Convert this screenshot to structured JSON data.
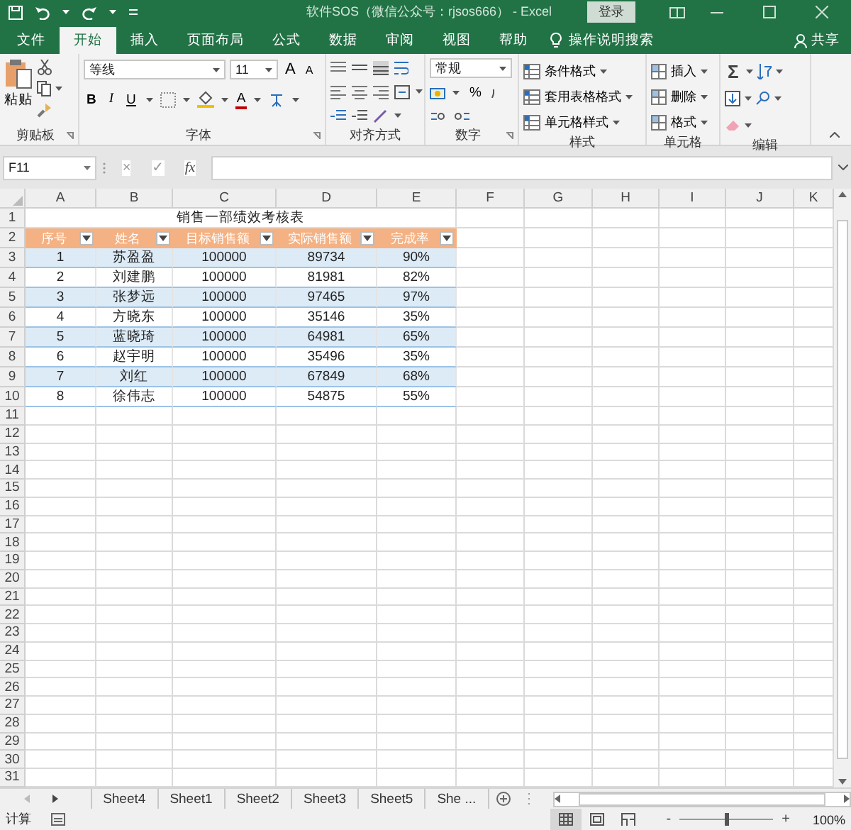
{
  "title_bar": {
    "title": "软件SOS（微信公众号：rjsos666） - Excel",
    "sign_in": "登录"
  },
  "ribbon_tabs": [
    {
      "label": "文件",
      "selected": false
    },
    {
      "label": "开始",
      "selected": true
    },
    {
      "label": "插入",
      "selected": false
    },
    {
      "label": "页面布局",
      "selected": false
    },
    {
      "label": "公式",
      "selected": false
    },
    {
      "label": "数据",
      "selected": false
    },
    {
      "label": "审阅",
      "selected": false
    },
    {
      "label": "视图",
      "selected": false
    },
    {
      "label": "帮助",
      "selected": false
    }
  ],
  "tell_me": "操作说明搜索",
  "share": "共享",
  "ribbon": {
    "clipboard": {
      "paste": "粘贴",
      "label": "剪贴板"
    },
    "font": {
      "font_name": "等线",
      "font_size": "11",
      "grow": "A",
      "shrink": "A",
      "bold": "B",
      "italic": "I",
      "underline": "U",
      "text_color_label": "A",
      "label": "字体"
    },
    "alignment": {
      "label": "对齐方式"
    },
    "number": {
      "format": "常规",
      "percent": "%",
      "label": "数字"
    },
    "styles": {
      "commands": [
        "条件格式",
        "套用表格格式",
        "单元格样式"
      ],
      "label": "样式"
    },
    "cells": {
      "commands": [
        "插入",
        "删除",
        "格式"
      ],
      "label": "单元格"
    },
    "editing": {
      "sum": "Σ",
      "label": "编辑"
    }
  },
  "formula_bar": {
    "name_box": "F11",
    "cancel": "×",
    "enter": "✓",
    "function": "fx"
  },
  "sheet": {
    "columns": [
      "A",
      "B",
      "C",
      "D",
      "E",
      "F",
      "G",
      "H",
      "I",
      "J",
      "K"
    ],
    "row_numbers": [
      "1",
      "2",
      "3",
      "4",
      "5",
      "6",
      "7",
      "8",
      "9",
      "10",
      "11",
      "12",
      "13",
      "14",
      "15",
      "16",
      "17",
      "18",
      "19",
      "20",
      "21",
      "22",
      "23",
      "24",
      "25",
      "26",
      "27",
      "28",
      "29",
      "30",
      "31"
    ],
    "table": {
      "title": "销售一部绩效考核表",
      "headers": [
        "序号",
        "姓名",
        "目标销售额",
        "实际销售额",
        "完成率"
      ],
      "rows": [
        [
          "1",
          "苏盈盈",
          "100000",
          "89734",
          "90%"
        ],
        [
          "2",
          "刘建鹏",
          "100000",
          "81981",
          "82%"
        ],
        [
          "3",
          "张梦远",
          "100000",
          "97465",
          "97%"
        ],
        [
          "4",
          "方晓东",
          "100000",
          "35146",
          "35%"
        ],
        [
          "5",
          "蓝晓琦",
          "100000",
          "64981",
          "65%"
        ],
        [
          "6",
          "赵宇明",
          "100000",
          "35496",
          "35%"
        ],
        [
          "7",
          "刘红",
          "100000",
          "67849",
          "68%"
        ],
        [
          "8",
          "徐伟志",
          "100000",
          "54875",
          "55%"
        ]
      ]
    }
  },
  "sheet_tabs": [
    {
      "label": "Sheet4",
      "selected": false
    },
    {
      "label": "Sheet1",
      "selected": false
    },
    {
      "label": "Sheet2",
      "selected": false
    },
    {
      "label": "Sheet3",
      "selected": false
    },
    {
      "label": "Sheet5",
      "selected": false
    },
    {
      "label": "She ...",
      "selected": false
    }
  ],
  "status_bar": {
    "mode": "计算",
    "views": [
      {
        "kind": "normal",
        "selected": true
      },
      {
        "kind": "page_layout",
        "selected": false
      },
      {
        "kind": "page_break",
        "selected": false
      }
    ],
    "zoom_out": "-",
    "zoom_in": "+",
    "zoom": {
      "level": 0.5,
      "reading": "100%"
    }
  }
}
